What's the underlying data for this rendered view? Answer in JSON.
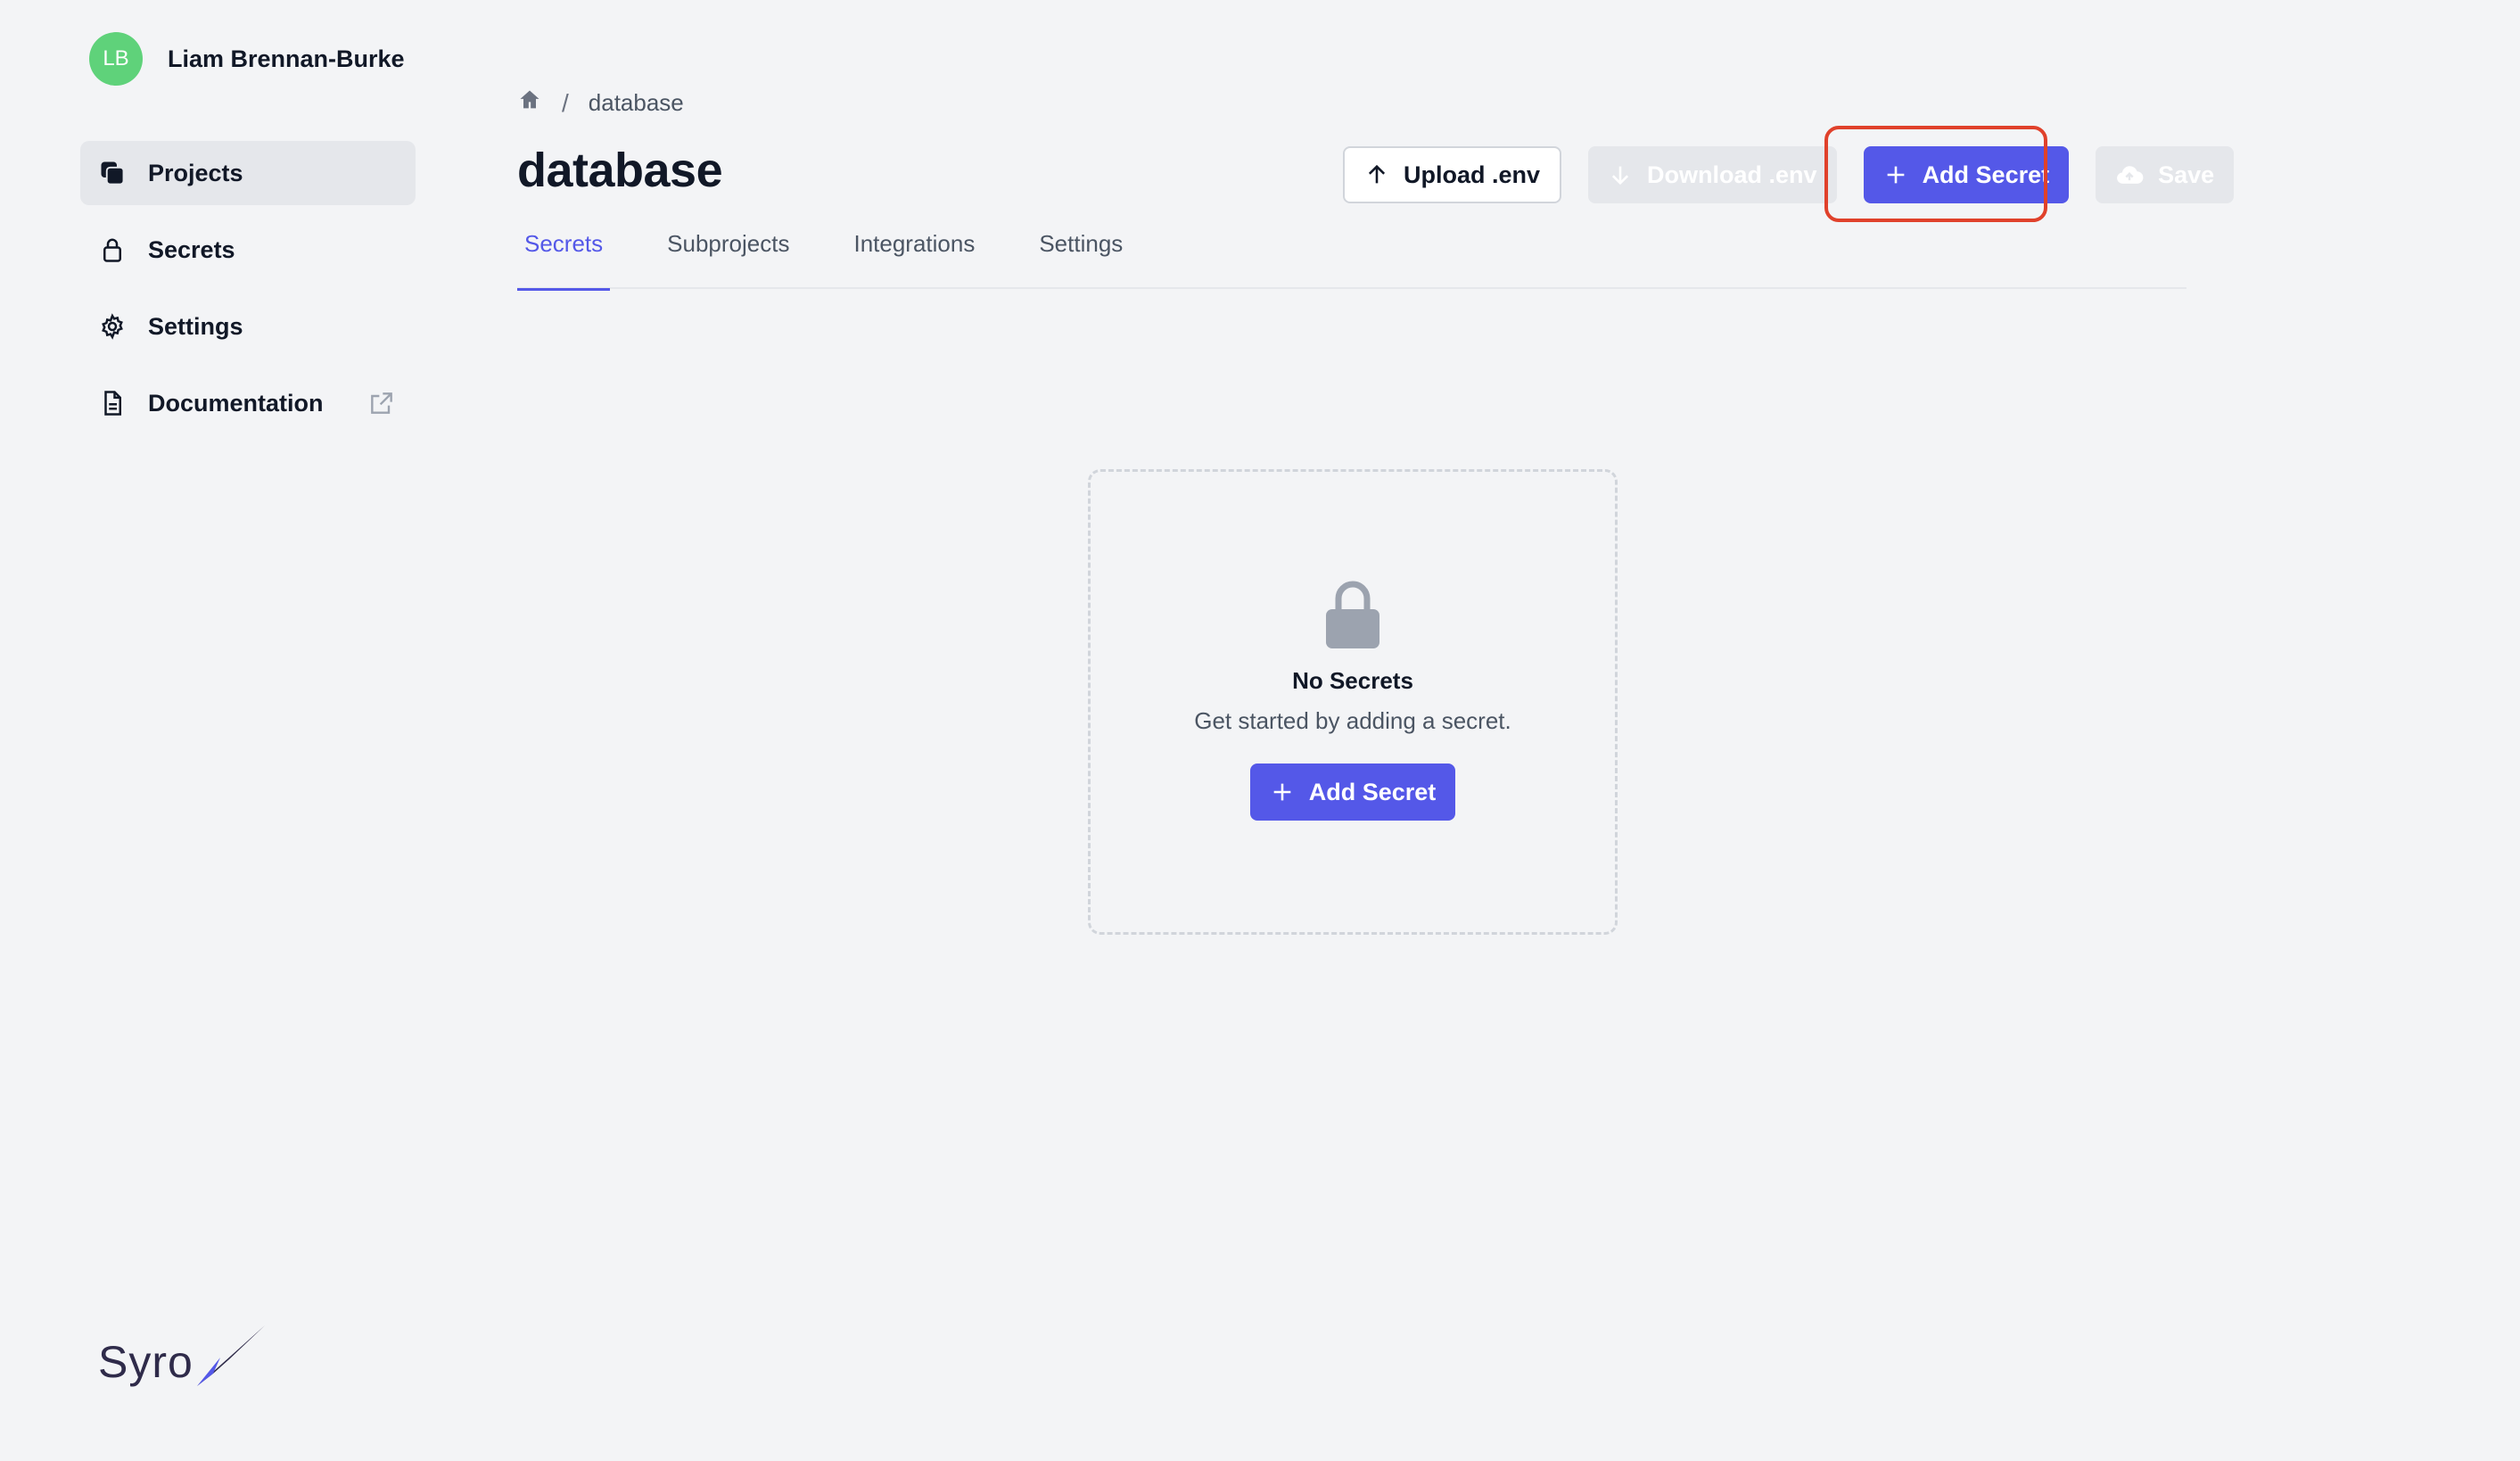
{
  "user": {
    "initials": "LB",
    "name": "Liam Brennan-Burke"
  },
  "sidebar": {
    "items": [
      {
        "label": "Projects",
        "icon": "projects-icon",
        "active": true
      },
      {
        "label": "Secrets",
        "icon": "lock-icon"
      },
      {
        "label": "Settings",
        "icon": "gear-icon"
      },
      {
        "label": "Documentation",
        "icon": "document-icon",
        "external": true
      }
    ]
  },
  "brand": {
    "name": "Syro"
  },
  "breadcrumb": {
    "separator": "/",
    "current": "database"
  },
  "page": {
    "title": "database"
  },
  "toolbar": {
    "upload_label": "Upload .env",
    "download_label": "Download .env",
    "add_secret_label": "Add Secret",
    "save_label": "Save"
  },
  "tabs": [
    {
      "label": "Secrets",
      "active": true
    },
    {
      "label": "Subprojects"
    },
    {
      "label": "Integrations"
    },
    {
      "label": "Settings"
    }
  ],
  "empty_state": {
    "title": "No Secrets",
    "subtitle": "Get started by adding a secret.",
    "button_label": "Add Secret"
  },
  "colors": {
    "primary": "#5458e8",
    "highlight": "#e0412b",
    "avatar": "#5fd27a"
  }
}
